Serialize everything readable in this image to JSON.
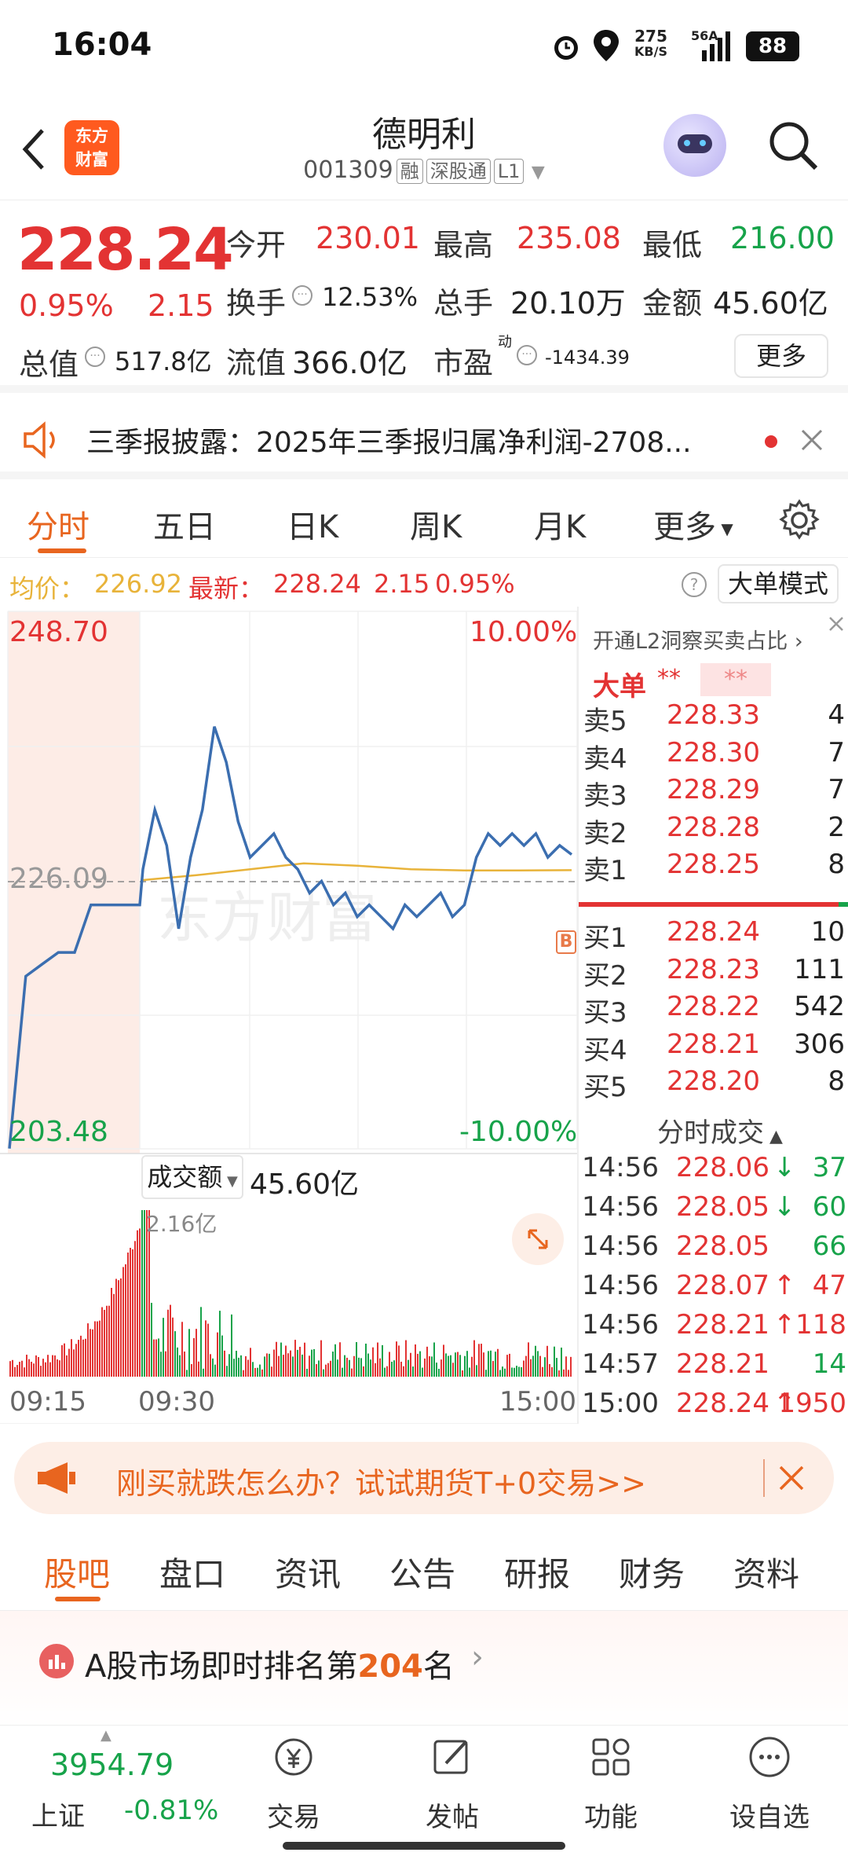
{
  "status_bar": {
    "time": "16:04",
    "net_speed": "275",
    "net_unit": "KB/S",
    "signal": "56A",
    "battery": "88"
  },
  "header": {
    "logo_line1": "东方",
    "logo_line2": "财富",
    "stock_name": "德明利",
    "stock_code": "001309",
    "tags": [
      "融",
      "深股通",
      "L1"
    ]
  },
  "quote": {
    "price": "228.24",
    "change_pct": "0.95%",
    "change_amt": "2.15",
    "open_label": "今开",
    "open": "230.01",
    "high_label": "最高",
    "high": "235.08",
    "low_label": "最低",
    "low": "216.00",
    "turnover_label": "换手",
    "turnover": "12.53%",
    "volume_label": "总手",
    "volume": "20.10万",
    "amount_label": "金额",
    "amount": "45.60亿",
    "mktcap_label": "总值",
    "mktcap": "517.8亿",
    "float_label": "流值",
    "float": "366.0亿",
    "pe_label": "市盈",
    "pe_sup": "动",
    "pe": "-1434.39",
    "more": "更多"
  },
  "notice": {
    "text": "三季报披露：2025年三季报归属净利润-2708..."
  },
  "chart_tabs": [
    "分时",
    "五日",
    "日K",
    "周K",
    "月K",
    "更多"
  ],
  "avg_line": {
    "avg_label": "均价：",
    "avg": "226.92",
    "last_label": "最新：",
    "last": "228.24",
    "chg": "2.15",
    "pct": "0.95%",
    "mode": "大单模式"
  },
  "chart_data": {
    "type": "line",
    "y_top_label": "248.70",
    "y_mid_label": "226.09",
    "y_bottom_label": "203.48",
    "pct_top": "10.00%",
    "pct_bottom": "-10.00%",
    "ylim": [
      203.48,
      248.7
    ],
    "x_ticks": [
      "09:15",
      "09:30",
      "15:00"
    ],
    "series": [
      {
        "values": [
          203.5,
          218,
          219,
          220,
          220,
          224,
          224,
          224,
          224,
          227,
          232,
          229,
          222,
          228,
          232,
          239,
          236,
          231,
          228,
          229,
          230,
          228,
          227,
          225,
          226,
          224,
          225,
          223,
          224,
          223,
          222,
          224,
          223,
          224,
          225,
          223,
          224,
          228,
          230,
          229,
          230,
          229,
          230,
          228,
          229,
          228.24
        ]
      },
      {
        "values": [
          226.09,
          226.5,
          227,
          227.5,
          227.3,
          227,
          226.9,
          226.9,
          226.92
        ]
      }
    ],
    "volume_label": "成交额",
    "volume_total": "45.60亿",
    "volume_max_label": "2.16亿"
  },
  "order_book": {
    "l2_hint": "开通L2洞察买卖占比",
    "big_label": "大单",
    "big_val1": "**",
    "big_val2": "**",
    "asks": [
      {
        "label": "卖5",
        "price": "228.33",
        "vol": "4"
      },
      {
        "label": "卖4",
        "price": "228.30",
        "vol": "7"
      },
      {
        "label": "卖3",
        "price": "228.29",
        "vol": "7"
      },
      {
        "label": "卖2",
        "price": "228.28",
        "vol": "2"
      },
      {
        "label": "卖1",
        "price": "228.25",
        "vol": "8"
      }
    ],
    "bids": [
      {
        "label": "买1",
        "price": "228.24",
        "vol": "10"
      },
      {
        "label": "买2",
        "price": "228.23",
        "vol": "111"
      },
      {
        "label": "买3",
        "price": "228.22",
        "vol": "542"
      },
      {
        "label": "买4",
        "price": "228.21",
        "vol": "306"
      },
      {
        "label": "买5",
        "price": "228.20",
        "vol": "8"
      }
    ],
    "trades_title": "分时成交",
    "trades": [
      {
        "time": "14:56",
        "price": "228.06",
        "arrow": "↓",
        "vol": "37",
        "pc": "red",
        "ac": "green",
        "vc": "green"
      },
      {
        "time": "14:56",
        "price": "228.05",
        "arrow": "↓",
        "vol": "60",
        "pc": "red",
        "ac": "green",
        "vc": "green"
      },
      {
        "time": "14:56",
        "price": "228.05",
        "arrow": "",
        "vol": "66",
        "pc": "red",
        "ac": "green",
        "vc": "green"
      },
      {
        "time": "14:56",
        "price": "228.07",
        "arrow": "↑",
        "vol": "47",
        "pc": "red",
        "ac": "red",
        "vc": "red"
      },
      {
        "time": "14:56",
        "price": "228.21",
        "arrow": "↑",
        "vol": "118",
        "pc": "red",
        "ac": "red",
        "vc": "red"
      },
      {
        "time": "14:57",
        "price": "228.21",
        "arrow": "",
        "vol": "14",
        "pc": "red",
        "ac": "green",
        "vc": "green"
      },
      {
        "time": "15:00",
        "price": "228.24",
        "arrow": "↑",
        "vol": "1950",
        "pc": "red",
        "ac": "red",
        "vc": "red"
      }
    ]
  },
  "banner": {
    "text": "刚买就跌怎么办？试试期货T+0交易>>"
  },
  "sub_tabs": [
    "股吧",
    "盘口",
    "资讯",
    "公告",
    "研报",
    "财务",
    "资料"
  ],
  "rank": {
    "prefix": "A股市场即时排名第",
    "num": "204",
    "suffix": "名"
  },
  "bottom_nav": {
    "index_value": "3954.79",
    "index_name": "上证",
    "index_pct": "-0.81%",
    "items": [
      "交易",
      "发帖",
      "功能",
      "设自选"
    ]
  },
  "colors": {
    "up": "#e33333",
    "down": "#17a34a",
    "accent": "#e8651f",
    "price_line": "#3b6eb0",
    "avg_line": "#e8b33a"
  }
}
